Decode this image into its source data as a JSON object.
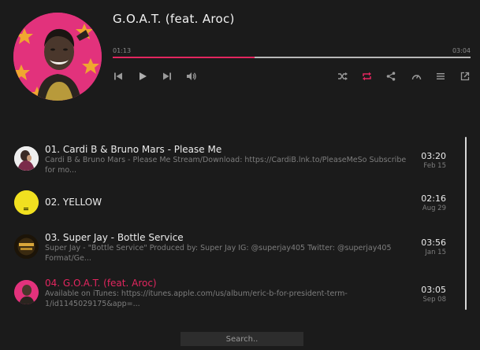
{
  "now_playing": {
    "title": "G.O.A.T. (feat. Aroc)",
    "elapsed": "01:13",
    "total": "03:04",
    "progress": 0.397
  },
  "controls": {
    "prev": "skip-back-icon",
    "play": "play-icon",
    "next": "skip-forward-icon",
    "volume": "volume-icon",
    "shuffle": "shuffle-icon",
    "repeat": "repeat-icon",
    "share": "share-icon",
    "speed": "speedometer-icon",
    "playlist": "list-icon",
    "popout": "external-link-icon"
  },
  "colors": {
    "accent": "#e3265f",
    "background": "#1b1b1b"
  },
  "tracks": [
    {
      "name": "01. Cardi B & Bruno Mars - Please Me",
      "desc": "Cardi B & Bruno Mars - Please Me Stream/Download: https://CardiB.lnk.to/PleaseMeSo Subscribe for mo...",
      "duration": "03:20",
      "date": "Feb 15"
    },
    {
      "name": "02. YELLOW",
      "desc": "",
      "duration": "02:16",
      "date": "Aug 29"
    },
    {
      "name": "03. Super Jay - Bottle Service",
      "desc": "Super Jay - \"Bottle Service\" Produced by: Super Jay IG: @superjay405 Twitter: @superjay405 Format/Ge...",
      "duration": "03:56",
      "date": "Jan 15"
    },
    {
      "name": "04. G.O.A.T. (feat. Aroc)",
      "desc": "Available on iTunes: https://itunes.apple.com/us/album/eric-b-for-president-term-1/id1145029175&app=...",
      "duration": "03:05",
      "date": "Sep 08"
    }
  ],
  "search": {
    "placeholder": "Search.."
  }
}
